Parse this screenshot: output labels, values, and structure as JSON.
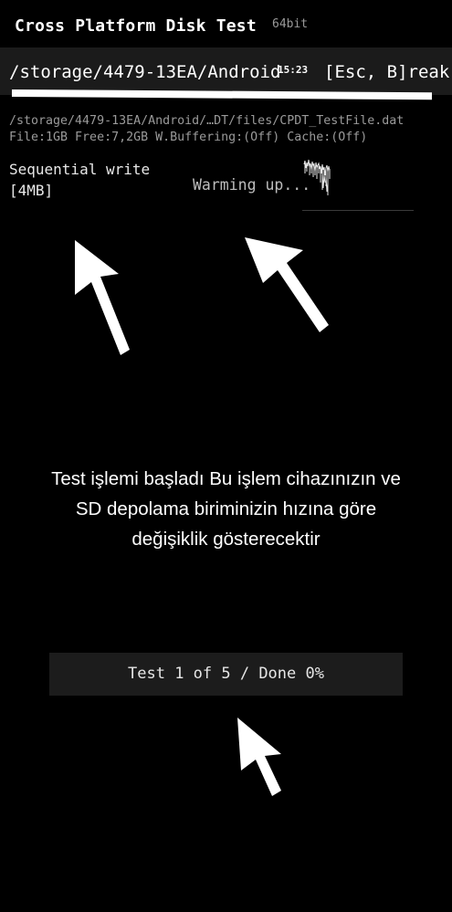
{
  "header": {
    "title": "Cross Platform Disk Test",
    "arch": "64bit"
  },
  "pathbar": {
    "path": "/storage/4479-13EA/Android",
    "time": "15:23",
    "esc_hint": "[Esc, B]reak"
  },
  "file_info": {
    "line1": "/storage/4479-13EA/Android/…DT/files/CPDT_TestFile.dat",
    "line2": "File:1GB Free:7,2GB W.Buffering:(Off) Cache:(Off)"
  },
  "test": {
    "name": "Sequential write",
    "block": "[4MB]",
    "status": "Warming up..."
  },
  "message": {
    "line1": "Test işlemi başladı Bu işlem cihazınızın ve",
    "line2": "SD depolama biriminizin hızına göre",
    "line3": "değişiklik gösterecektir"
  },
  "progress": {
    "label": "Test 1 of 5 / Done 0%"
  }
}
